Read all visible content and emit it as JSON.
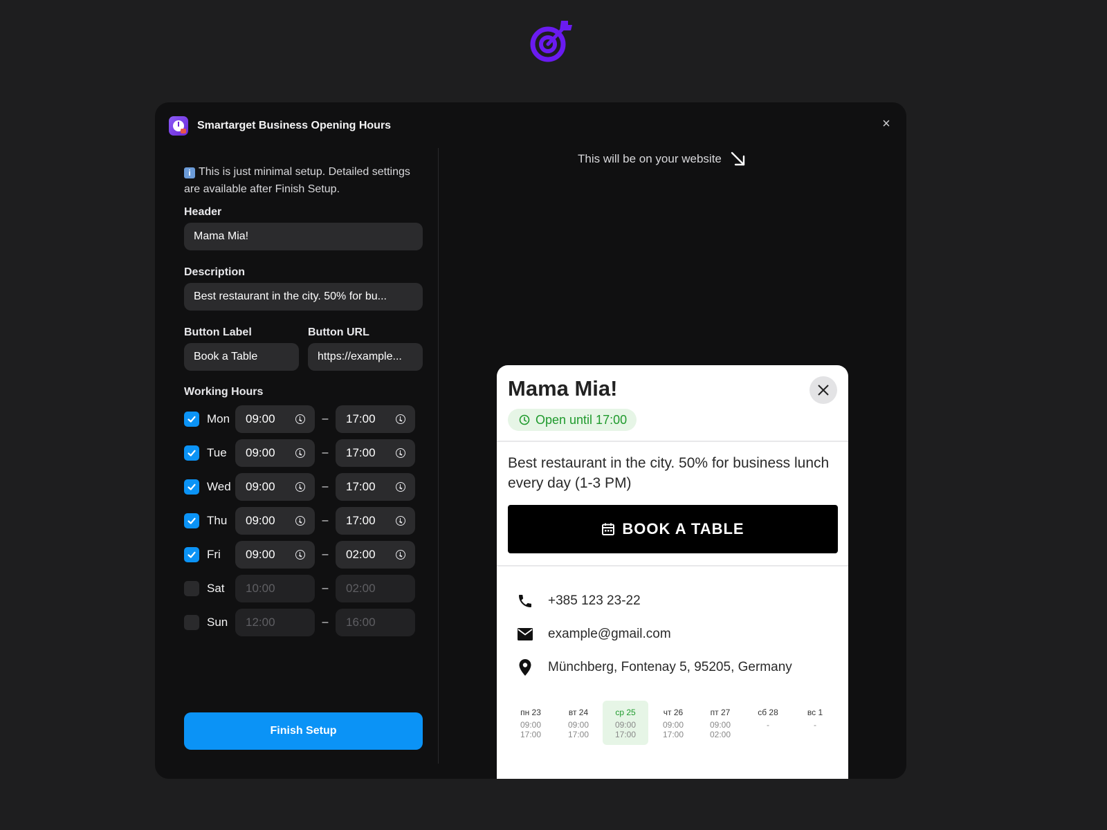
{
  "brand": {
    "logo_icon": "smartarget-target-logo-icon",
    "accent": "#6a1bf0"
  },
  "modal": {
    "title": "Smartarget Business Opening Hours",
    "close_label": "×"
  },
  "setup": {
    "info_text": "This is just minimal setup. Detailed settings are available after Finish Setup.",
    "header_label": "Header",
    "header_value": "Mama Mia!",
    "description_label": "Description",
    "description_value": "Best restaurant in the city. 50% for bu...",
    "button_label_label": "Button Label",
    "button_label_value": "Book a Table",
    "button_url_label": "Button URL",
    "button_url_value": "https://example...",
    "working_hours_label": "Working Hours",
    "dash": "–",
    "days": [
      {
        "day": "Mon",
        "enabled": true,
        "from": "09:00",
        "to": "17:00"
      },
      {
        "day": "Tue",
        "enabled": true,
        "from": "09:00",
        "to": "17:00"
      },
      {
        "day": "Wed",
        "enabled": true,
        "from": "09:00",
        "to": "17:00"
      },
      {
        "day": "Thu",
        "enabled": true,
        "from": "09:00",
        "to": "17:00"
      },
      {
        "day": "Fri",
        "enabled": true,
        "from": "09:00",
        "to": "02:00"
      },
      {
        "day": "Sat",
        "enabled": false,
        "from": "10:00",
        "to": "02:00"
      },
      {
        "day": "Sun",
        "enabled": false,
        "from": "12:00",
        "to": "16:00"
      }
    ],
    "finish_label": "Finish Setup",
    "primary_color": "#0b93f6"
  },
  "preview": {
    "hint": "This will be on your website",
    "card": {
      "title": "Mama Mia!",
      "status": "Open until 17:00",
      "status_color": "#1f9a2d",
      "description": "Best restaurant in the city. 50% for business lunch every day (1-3 PM)",
      "cta": "BOOK A TABLE",
      "phone": "+385 123 23-22",
      "email": "example@gmail.com",
      "address": "Münchberg, Fontenay 5, 95205, Germany",
      "week": [
        {
          "name": "пн 23",
          "open": "09:00",
          "close": "17:00",
          "today": false
        },
        {
          "name": "вт 24",
          "open": "09:00",
          "close": "17:00",
          "today": false
        },
        {
          "name": "ср 25",
          "open": "09:00",
          "close": "17:00",
          "today": true
        },
        {
          "name": "чт 26",
          "open": "09:00",
          "close": "17:00",
          "today": false
        },
        {
          "name": "пт 27",
          "open": "09:00",
          "close": "02:00",
          "today": false
        },
        {
          "name": "сб 28",
          "open": "-",
          "close": "",
          "today": false
        },
        {
          "name": "вс 1",
          "open": "-",
          "close": "",
          "today": false
        }
      ]
    }
  }
}
